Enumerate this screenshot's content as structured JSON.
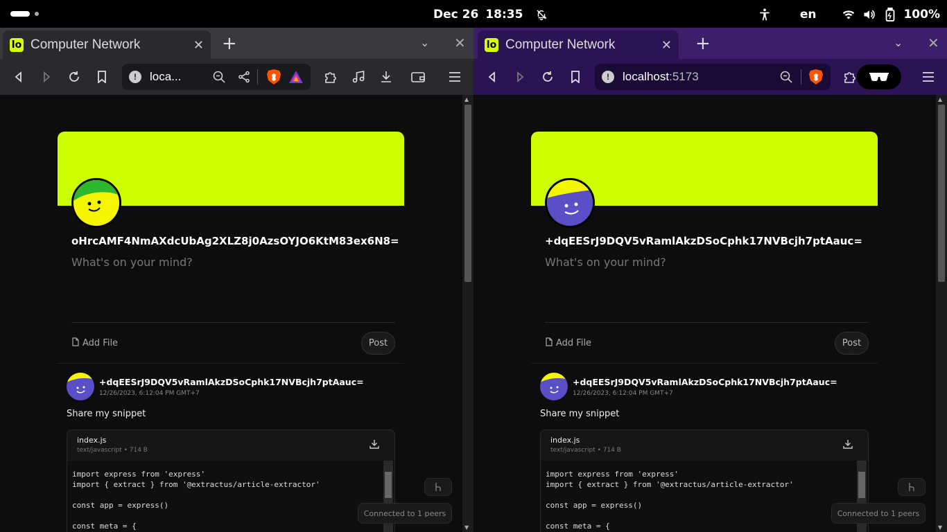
{
  "system_bar": {
    "date": "Dec 26",
    "time": "18:35",
    "language": "en",
    "battery": "100%",
    "icons": [
      "notifications-off-icon",
      "accessibility-icon",
      "wifi-icon",
      "volume-icon",
      "battery-icon"
    ]
  },
  "windows": [
    {
      "id": "left",
      "tab_title": "Computer Network",
      "url_host": "loca...",
      "url_port": "",
      "theme_colors": {
        "tabbar": "#3a3a3e",
        "toolbar": "#2a2a2e"
      },
      "profile": {
        "handle": "oHrcAMF4NmAXdcUbAg2XLZ8j0AzsOYJO6KtM83ex6N8=",
        "avatar_colors": {
          "top": "#2eb82e",
          "face": "#f5f500"
        },
        "composer_placeholder": "What's on your mind?",
        "add_file_label": "Add File",
        "post_label": "Post"
      },
      "post": {
        "author": "+dqEESrJ9DQV5vRamlAkzDSoCphk17NVBcjh7ptAauc=",
        "timestamp": "12/26/2023, 6:12:04 PM GMT+7",
        "text": "Share my snippet",
        "avatar_colors": {
          "top": "#f5f500",
          "face": "#5b4fc7"
        },
        "attachment": {
          "name": "index.js",
          "meta": "text/javascript • 714 B",
          "code": "import express from 'express'\nimport { extract } from '@extractus/article-extractor'\n\nconst app = express()\n\nconst meta = {"
        }
      },
      "status": "Connected to 1 peers"
    },
    {
      "id": "right",
      "tab_title": "Computer Network",
      "url_host": "localhost",
      "url_port": ":5173",
      "theme_colors": {
        "tabbar": "#3b1f6a",
        "toolbar": "#2c1354"
      },
      "profile": {
        "handle": "+dqEESrJ9DQV5vRamlAkzDSoCphk17NVBcjh7ptAauc=",
        "avatar_colors": {
          "top": "#f5f500",
          "face": "#5b4fc7"
        },
        "composer_placeholder": "What's on your mind?",
        "add_file_label": "Add File",
        "post_label": "Post"
      },
      "post": {
        "author": "+dqEESrJ9DQV5vRamlAkzDSoCphk17NVBcjh7ptAauc=",
        "timestamp": "12/26/2023, 6:12:04 PM GMT+7",
        "text": "Share my snippet",
        "avatar_colors": {
          "top": "#f5f500",
          "face": "#5b4fc7"
        },
        "attachment": {
          "name": "index.js",
          "meta": "text/javascript • 714 B",
          "code": "import express from 'express'\nimport { extract } from '@extractus/article-extractor'\n\nconst app = express()\n\nconst meta = {"
        }
      },
      "status": "Connected to 1 peers"
    }
  ],
  "accent": "#ccff00"
}
